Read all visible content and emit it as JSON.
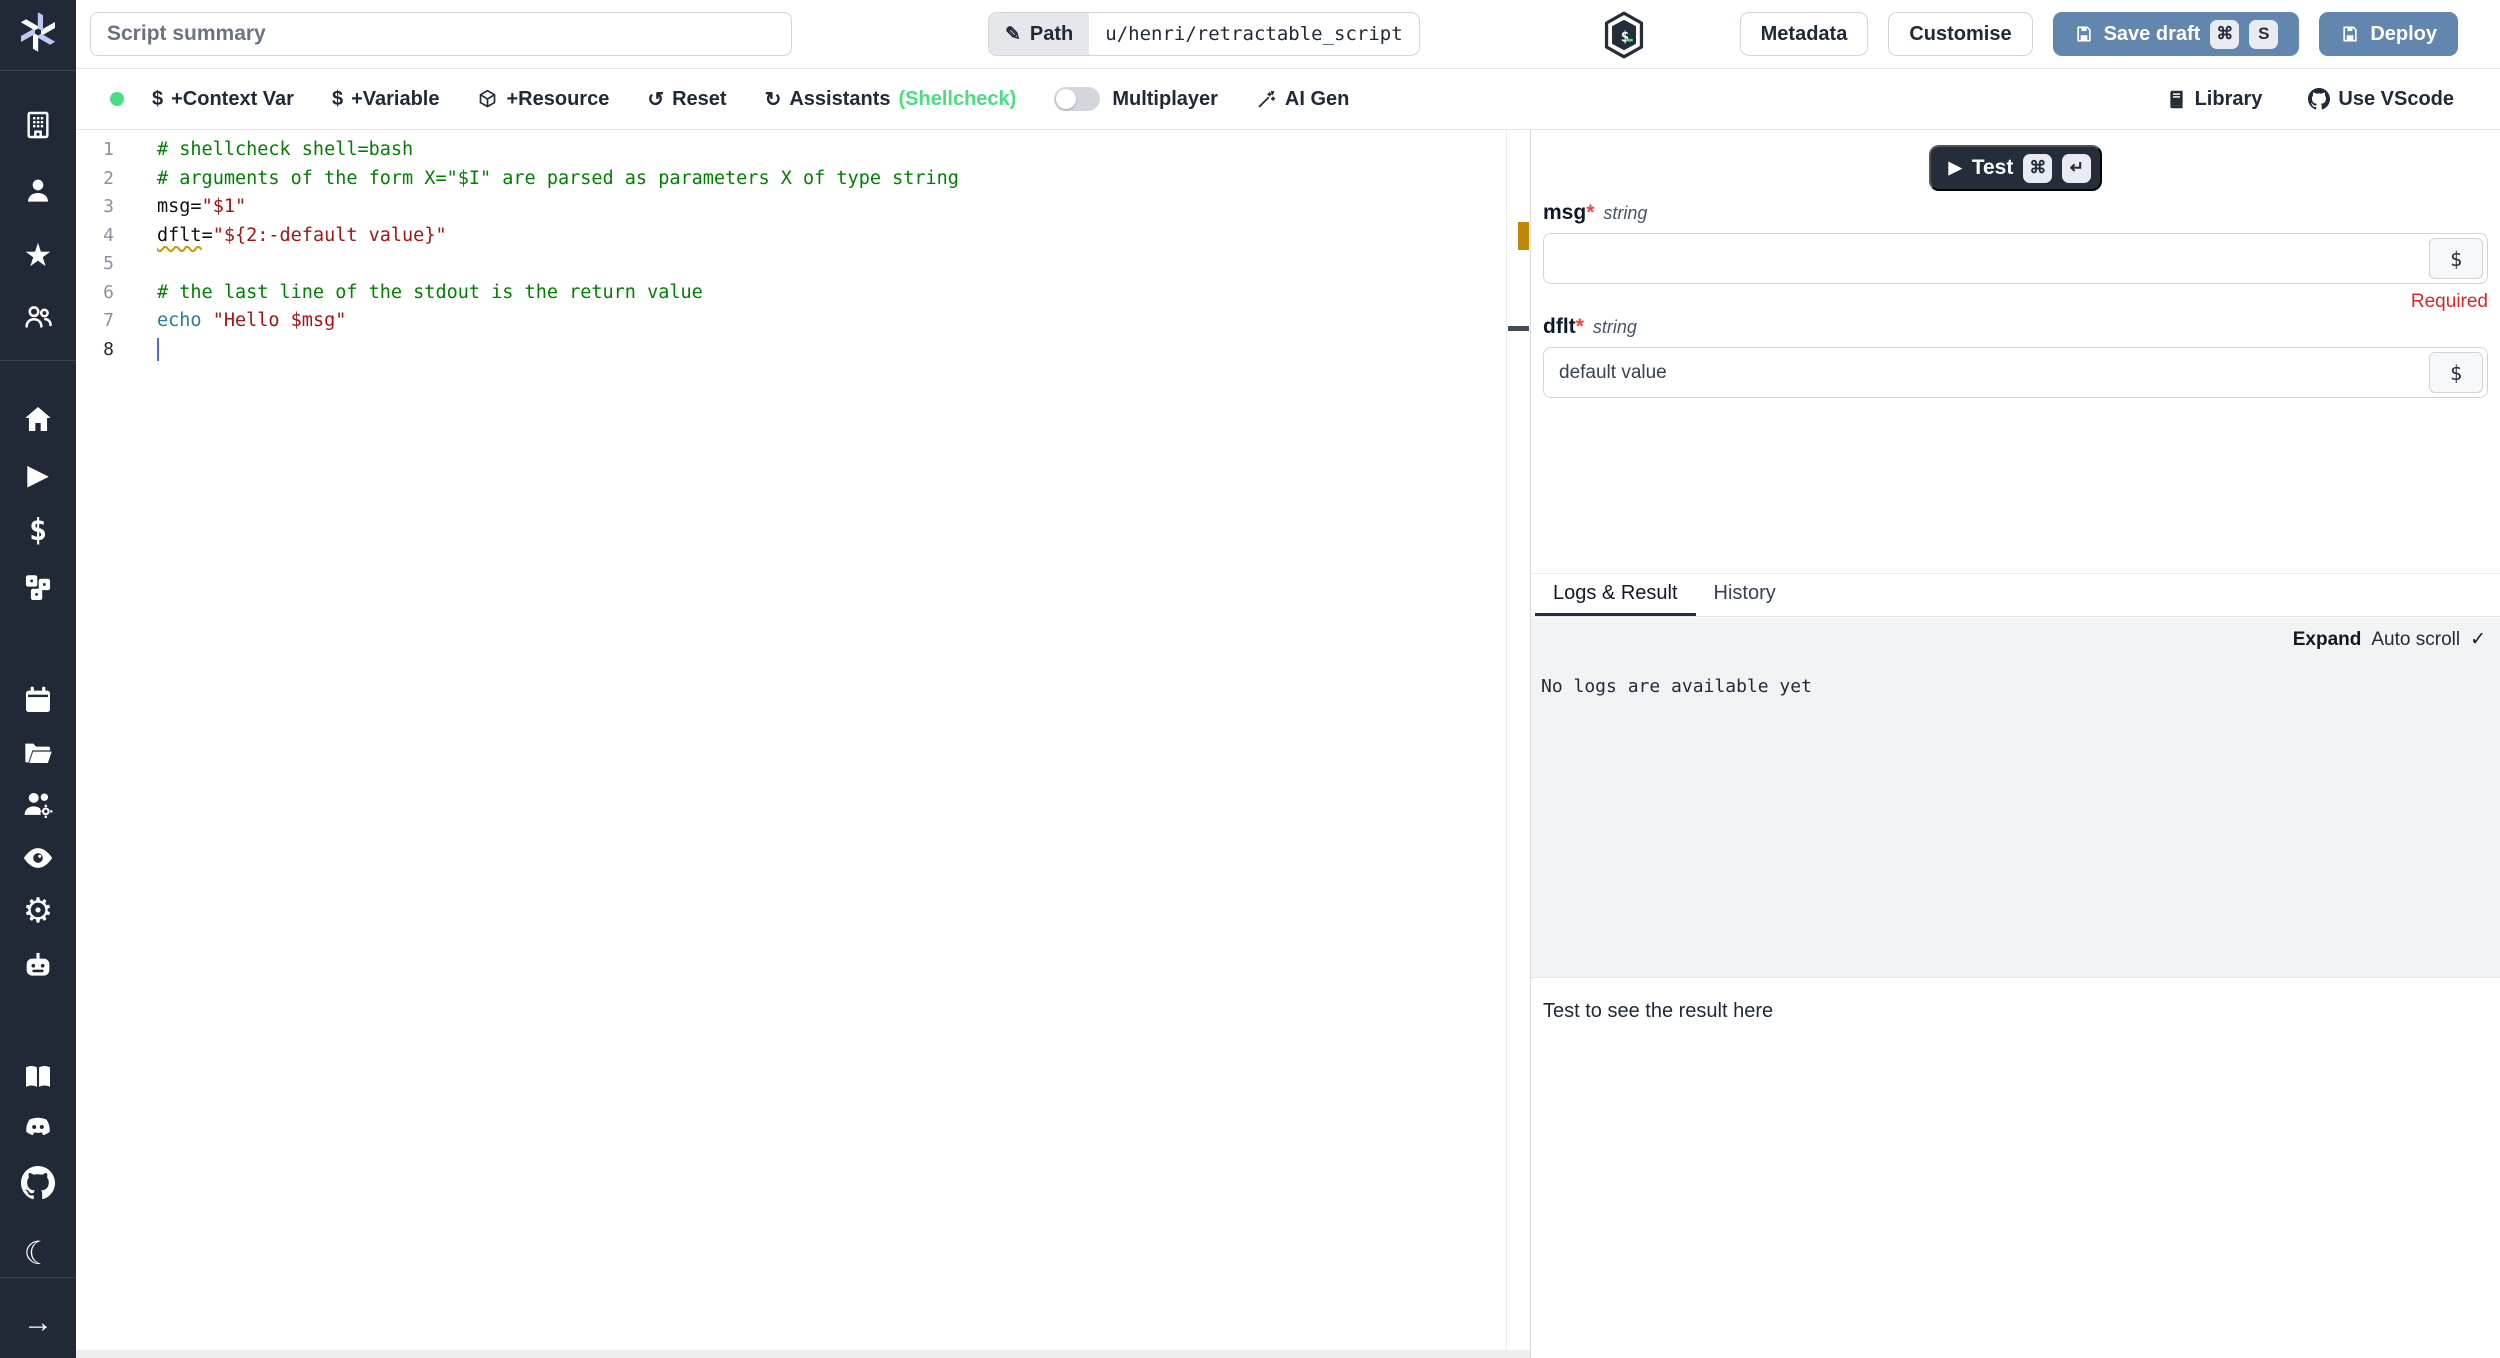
{
  "topbar": {
    "summary_placeholder": "Script summary",
    "path": {
      "edit_icon": "✎",
      "label": "Path",
      "value": "u/henri/retractable_script"
    },
    "metadata_label": "Metadata",
    "customise_label": "Customise",
    "save_draft": {
      "label": "Save draft",
      "kbd_cmd": "⌘",
      "kbd_key": "S"
    },
    "deploy_label": "Deploy"
  },
  "toolbar": {
    "context_var": {
      "icon": "$",
      "label": "+Context Var"
    },
    "variable": {
      "icon": "$",
      "label": "+Variable"
    },
    "resource_label": "+Resource",
    "reset": {
      "icon": "↺",
      "label": "Reset"
    },
    "assistants": {
      "icon": "↻",
      "label": "Assistants",
      "detail": "(Shellcheck)"
    },
    "multiplayer_label": "Multiplayer",
    "ai_gen_label": "AI Gen",
    "library_label": "Library",
    "use_vscode_label": "Use VScode"
  },
  "editor": {
    "line_numbers": [
      "1",
      "2",
      "3",
      "4",
      "5",
      "6",
      "7",
      "8"
    ],
    "l1": "# shellcheck shell=bash",
    "l2": "# arguments of the form X=\"$I\" are parsed as parameters X of type string",
    "l3_var": "msg=",
    "l3_str": "\"$1\"",
    "l4_var": "dflt",
    "l4_eq": "=",
    "l4_str": "\"${2:-default value}\"",
    "l6": "# the last line of the stdout is the return value",
    "l7_cmd": "echo",
    "l7_str": " \"Hello $msg\""
  },
  "panel": {
    "test": {
      "label": "Test",
      "play_icon": "▶",
      "kbd_cmd": "⌘",
      "kbd_enter": "↵"
    },
    "fields": [
      {
        "label": "msg",
        "required_mark": "*",
        "type": "string",
        "value": "",
        "expr_button": "$",
        "validation": "Required"
      },
      {
        "label": "dflt",
        "required_mark": "*",
        "type": "string",
        "value": "default value",
        "expr_button": "$"
      }
    ],
    "tabs": [
      {
        "label": "Logs & Result"
      },
      {
        "label": "History"
      }
    ],
    "logs": {
      "expand": "Expand",
      "autoscroll": "Auto scroll",
      "check": "✓",
      "empty": "No logs are available yet"
    },
    "result": {
      "placeholder": "Test to see the result here"
    }
  },
  "sidebar": {
    "icons": [
      "windmill-logo",
      "workspace",
      "user",
      "favorites",
      "groups",
      "home",
      "runs",
      "variables",
      "resources",
      "schedules",
      "folders",
      "workers",
      "audit-logs",
      "settings",
      "ai",
      "docs",
      "discord",
      "github",
      "dark-mode",
      "collapse"
    ]
  },
  "colors": {
    "primary_button": "#6286ad",
    "sidebar_bg": "#212936",
    "accent_green": "#4ade80",
    "comment_green": "#008000",
    "string_red": "#a31515",
    "builtin_teal": "#267f99",
    "warning_marker": "#bf8803",
    "required_red": "#dc2626"
  }
}
